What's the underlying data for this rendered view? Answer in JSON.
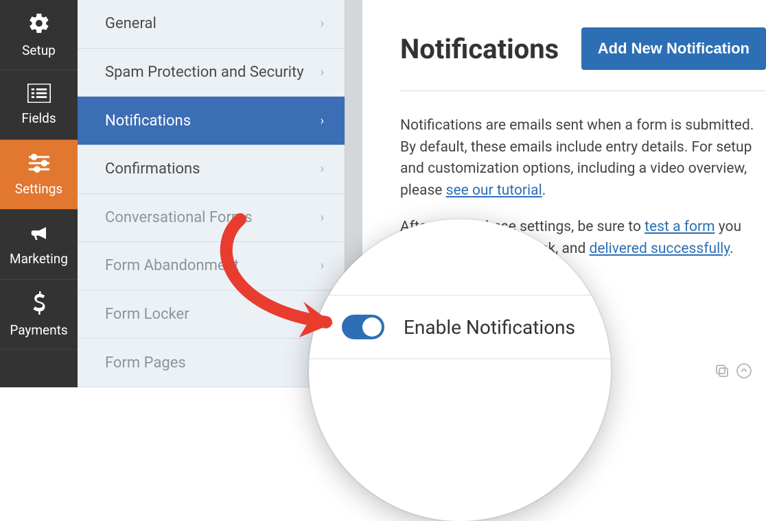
{
  "left_nav": {
    "items": [
      {
        "label": "Setup",
        "icon": "gear"
      },
      {
        "label": "Fields",
        "icon": "list"
      },
      {
        "label": "Settings",
        "icon": "sliders",
        "active": true
      },
      {
        "label": "Marketing",
        "icon": "megaphone"
      },
      {
        "label": "Payments",
        "icon": "dollar"
      }
    ]
  },
  "sub_sidebar": {
    "items": [
      {
        "label": "General"
      },
      {
        "label": "Spam Protection and Security"
      },
      {
        "label": "Notifications",
        "active": true
      },
      {
        "label": "Confirmations"
      },
      {
        "label": "Conversational Forms",
        "muted": true
      },
      {
        "label": "Form Abandonment",
        "muted": true
      },
      {
        "label": "Form Locker",
        "muted": true
      },
      {
        "label": "Form Pages",
        "muted": true
      }
    ]
  },
  "main": {
    "title": "Notifications",
    "button": "Add New Notification",
    "para1_a": "Notifications are emails sent when a form is submitted. By default, these emails include entry details. For setup and customization options, including a video overview, please ",
    "para1_link": "see our tutorial",
    "para1_b": ".",
    "para2_a": "After saving these settings, be sure to ",
    "para2_link1": "test a form",
    "para2_mid": " you see how emails will look, and ",
    "para2_link2": "delivered successfully",
    "para2_b": "."
  },
  "magnifier": {
    "toggle_label": "Enable Notifications",
    "toggle_on": true
  },
  "colors": {
    "accent": "#2d6fb4",
    "active_nav": "#e27730"
  }
}
